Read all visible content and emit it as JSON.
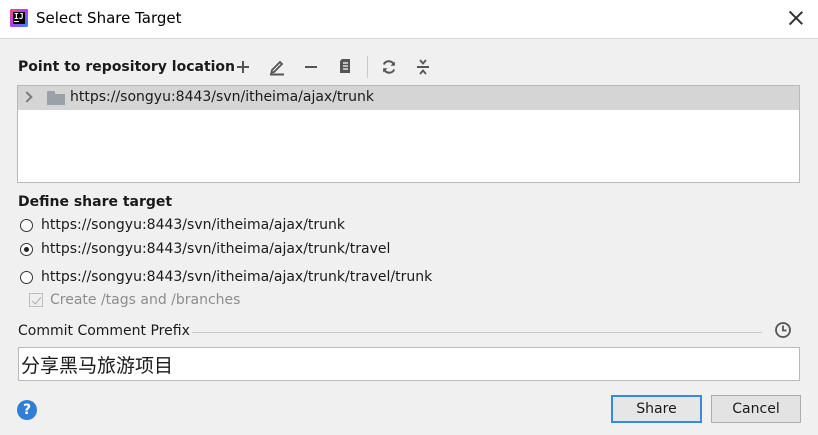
{
  "window": {
    "title": "Select Share Target",
    "app_icon_text": "IJ"
  },
  "repository": {
    "label": "Point to repository location",
    "toolbar_icons": [
      "add-icon",
      "edit-icon",
      "remove-icon",
      "browse-icon",
      "refresh-icon",
      "collapse-icon"
    ],
    "items": [
      {
        "url": "https://songyu:8443/svn/itheima/ajax/trunk"
      }
    ]
  },
  "share_target": {
    "label": "Define share target",
    "options": [
      {
        "label": "https://songyu:8443/svn/itheima/ajax/trunk",
        "checked": false
      },
      {
        "label": "https://songyu:8443/svn/itheima/ajax/trunk/travel",
        "checked": true
      },
      {
        "label": "https://songyu:8443/svn/itheima/ajax/trunk/travel/trunk",
        "checked": false
      }
    ],
    "create_tags_label": "Create /tags and /branches",
    "create_tags_checked": true,
    "create_tags_enabled": false
  },
  "commit": {
    "label": "Commit Comment Prefix",
    "value": "分享黑马旅游项目"
  },
  "buttons": {
    "share": "Share",
    "cancel": "Cancel",
    "help": "?"
  },
  "colors": {
    "accent": "#3a8ad9",
    "help": "#2f7fd6",
    "selected_row": "#d5d5d5"
  }
}
